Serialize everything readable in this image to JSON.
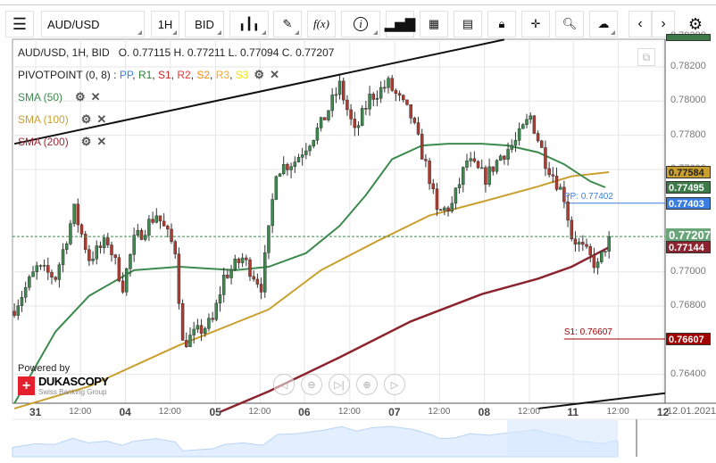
{
  "toolbar": {
    "menu_icon": "hamburger-icon",
    "symbol": "AUD/USD",
    "timeframe": "1H",
    "side": "BID",
    "icons": [
      "candlestick-icon",
      "pencil-icon",
      "function-icon",
      "info-icon",
      "bar-chart-icon",
      "calendar-icon",
      "report-icon",
      "lock-icon",
      "crosshair-icon",
      "zoom-chart-icon",
      "cloud-upload-icon",
      "chevron-left-icon",
      "chevron-right-icon",
      "gear-icon"
    ],
    "fx_label": "f(x)",
    "info_label": "i"
  },
  "legend": {
    "title": "AUD/USD, 1H, BID",
    "ohlc": "O. 0.77115 H. 0.77211 L. 0.77094 C. 0.77207",
    "pivot": "PIVOTPOINT (0, 8)",
    "pivot_sep": " :",
    "pivot_items": [
      {
        "label": "PP",
        "color": "#3a7fe0"
      },
      {
        "label": "R1",
        "color": "#2e7d32"
      },
      {
        "label": "S1",
        "color": "#c62828"
      },
      {
        "label": "R2",
        "color": "#e53935"
      },
      {
        "label": "S2",
        "color": "#fb8c00"
      },
      {
        "label": "R3",
        "color": "#f9a825"
      },
      {
        "label": "S3",
        "color": "#f5e400"
      }
    ],
    "sma": [
      {
        "label": "SMA (50)",
        "color": "#3c8a4e"
      },
      {
        "label": "SMA (100)",
        "color": "#c9a030"
      },
      {
        "label": "SMA (200)",
        "color": "#9b2a35"
      }
    ]
  },
  "chart_data": {
    "type": "candlestick",
    "symbol": "AUD/USD",
    "ylim": [
      0.76231,
      0.78362
    ],
    "xlim": [
      -0.5,
      174
    ],
    "y_ticks": [
      "0.78380",
      "0.78200",
      "0.78000",
      "0.77800",
      "0.77600",
      "0.77000",
      "0.76800",
      "0.76400"
    ],
    "y_tick_values": [
      0.7838,
      0.782,
      0.78,
      0.778,
      0.776,
      0.77,
      0.768,
      0.764
    ],
    "x_days": [
      {
        "label": "31",
        "i": 5.7
      },
      {
        "label": "04",
        "i": 29.7
      },
      {
        "label": "05",
        "i": 53.8
      },
      {
        "label": "06",
        "i": 77.6
      },
      {
        "label": "07",
        "i": 101.7
      },
      {
        "label": "08",
        "i": 125.7
      },
      {
        "label": "11",
        "i": 149.5
      },
      {
        "label": "12",
        "i": 173.5
      }
    ],
    "x_hours": [
      {
        "label": "12:00",
        "i": 17.7
      },
      {
        "label": "12:00",
        "i": 41.7
      },
      {
        "label": "12:00",
        "i": 65.7
      },
      {
        "label": "12:00",
        "i": 89.7
      },
      {
        "label": "12:00",
        "i": 113.7
      },
      {
        "label": "12:00",
        "i": 137.7
      },
      {
        "label": "12:00",
        "i": 161.5
      }
    ],
    "x_end_label": "12.01.2021",
    "price_path": [
      [
        0,
        0.7679
      ],
      [
        6,
        0.7702
      ],
      [
        11,
        0.7697
      ],
      [
        16,
        0.7736
      ],
      [
        20,
        0.7708
      ],
      [
        25,
        0.7718
      ],
      [
        29,
        0.7692
      ],
      [
        32,
        0.7718
      ],
      [
        38,
        0.7734
      ],
      [
        43,
        0.7713
      ],
      [
        45,
        0.7658
      ],
      [
        48,
        0.7663
      ],
      [
        53,
        0.7671
      ],
      [
        56,
        0.7697
      ],
      [
        61,
        0.7708
      ],
      [
        66,
        0.7692
      ],
      [
        68,
        0.7723
      ],
      [
        70,
        0.776
      ],
      [
        75,
        0.7765
      ],
      [
        82,
        0.7786
      ],
      [
        87,
        0.7809
      ],
      [
        91,
        0.7781
      ],
      [
        95,
        0.7802
      ],
      [
        100,
        0.781
      ],
      [
        106,
        0.7791
      ],
      [
        111,
        0.7755
      ],
      [
        113,
        0.7734
      ],
      [
        117,
        0.7739
      ],
      [
        121,
        0.7765
      ],
      [
        126,
        0.7755
      ],
      [
        130,
        0.7768
      ],
      [
        134,
        0.7776
      ],
      [
        138,
        0.7791
      ],
      [
        142,
        0.7765
      ],
      [
        144,
        0.7757
      ],
      [
        147,
        0.7744
      ],
      [
        149,
        0.7721
      ],
      [
        154,
        0.7708
      ],
      [
        156,
        0.7703
      ],
      [
        159,
        0.77207
      ]
    ],
    "sma50": [
      [
        0,
        0.7623
      ],
      [
        11,
        0.7665
      ],
      [
        20,
        0.7686
      ],
      [
        32,
        0.7701
      ],
      [
        44,
        0.7703
      ],
      [
        59,
        0.7701
      ],
      [
        68,
        0.7703
      ],
      [
        78,
        0.7711
      ],
      [
        87,
        0.7727
      ],
      [
        94,
        0.7745
      ],
      [
        101,
        0.7766
      ],
      [
        109,
        0.7774
      ],
      [
        116,
        0.7775
      ],
      [
        125,
        0.7775
      ],
      [
        132,
        0.7774
      ],
      [
        140,
        0.777
      ],
      [
        147,
        0.7763
      ],
      [
        154,
        0.7753
      ],
      [
        158,
        0.77495
      ]
    ],
    "sma100": [
      [
        0,
        0.762
      ],
      [
        20,
        0.7633
      ],
      [
        44,
        0.7657
      ],
      [
        68,
        0.7678
      ],
      [
        82,
        0.7701
      ],
      [
        97,
        0.7718
      ],
      [
        111,
        0.7733
      ],
      [
        125,
        0.7741
      ],
      [
        140,
        0.775
      ],
      [
        149,
        0.7756
      ],
      [
        159,
        0.77584
      ]
    ],
    "sma200": [
      [
        55,
        0.7618
      ],
      [
        68,
        0.763
      ],
      [
        87,
        0.765
      ],
      [
        106,
        0.7671
      ],
      [
        125,
        0.7687
      ],
      [
        140,
        0.7696
      ],
      [
        149,
        0.7703
      ],
      [
        159,
        0.77144
      ]
    ],
    "trendlines": [
      [
        [
          0,
          0.7775
        ],
        [
          131,
          0.7836
        ]
      ],
      [
        [
          140,
          0.762
        ],
        [
          174,
          0.7629
        ]
      ]
    ],
    "pivot_lines": [
      {
        "label": "PP: 0.77402",
        "value": 0.77402,
        "color": "#3a7fe0"
      },
      {
        "label": "S1: 0.76607",
        "value": 0.76607,
        "color": "#a00000"
      }
    ],
    "price_labels": [
      {
        "text": "0.77584",
        "value": 0.77584,
        "bg": "#c9a030",
        "fg": "#222"
      },
      {
        "text": "0.77495",
        "value": 0.77495,
        "bg": "#3c7a48",
        "fg": "#fff"
      },
      {
        "text": "0.77403",
        "value": 0.77403,
        "bg": "#3a7fe0",
        "fg": "#fff"
      },
      {
        "text": "0.77207",
        "value": 0.77207,
        "bg": "#6aa57a",
        "fg": "#fff"
      },
      {
        "text": "0.77144",
        "value": 0.77144,
        "bg": "#8c2430",
        "fg": "#fff"
      },
      {
        "text": "0.76607",
        "value": 0.76607,
        "bg": "#a00000",
        "fg": "#fff"
      }
    ],
    "current_price": 0.77207
  },
  "branding": {
    "powered": "Powered by",
    "name": "DUKASCOPY",
    "tagline": "Swiss Banking Group"
  },
  "nav_buttons": [
    "scroll-left",
    "zoom-out",
    "scroll-end",
    "zoom-in",
    "scroll-right"
  ]
}
